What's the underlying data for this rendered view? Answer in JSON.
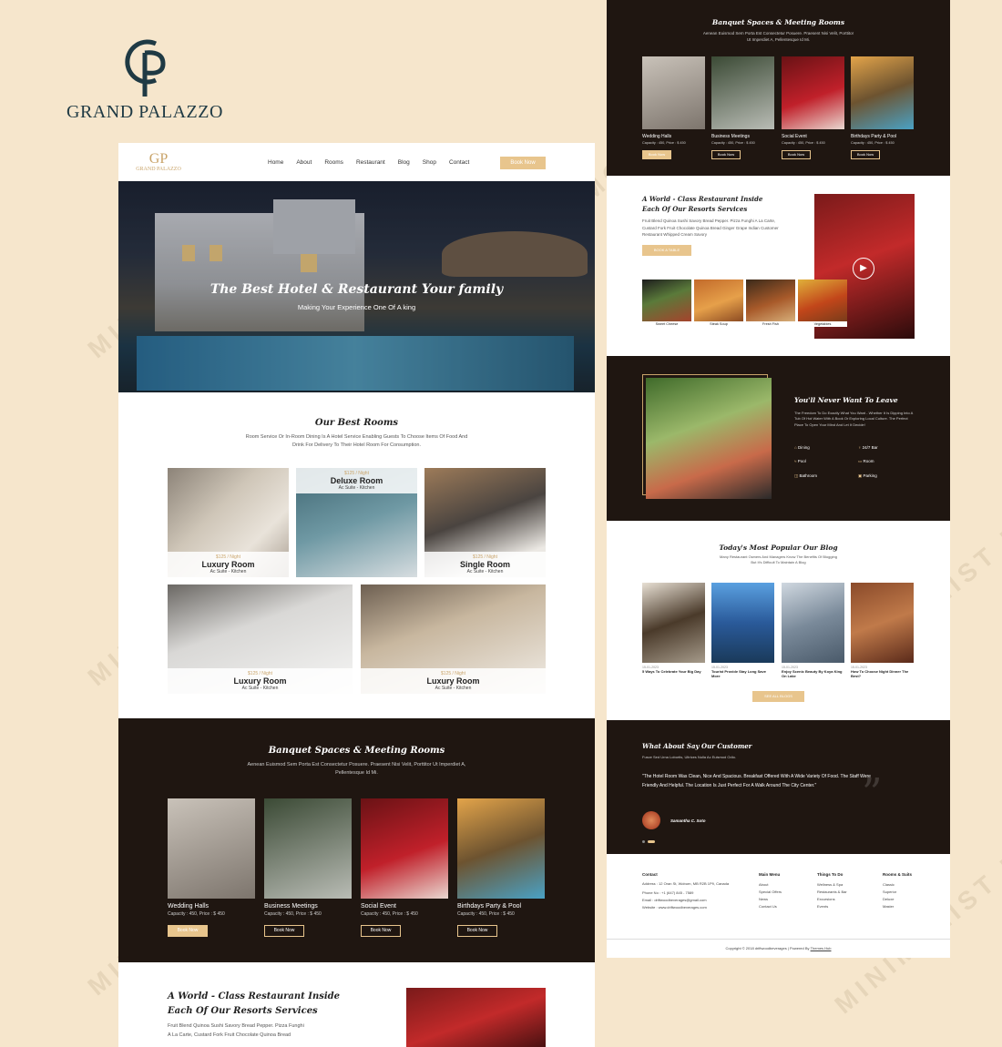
{
  "brand": {
    "monogram": "GP",
    "name": "GRAND PALAZZO"
  },
  "watermark": "MINIMALIST MOON",
  "left": {
    "logo": {
      "mark": "GP",
      "name": "GRAND PALAZZO"
    },
    "nav": [
      "Home",
      "About",
      "Rooms",
      "Restaurant",
      "Blog",
      "Shop",
      "Contact"
    ],
    "book_now": "Book Now",
    "hero": {
      "title": "The Best Hotel & Restaurant Your family",
      "subtitle": "Making Your Experience One Of A king"
    },
    "rooms": {
      "title": "Our Best Rooms",
      "subtitle": "Room Service Or In-Room Dining Is A Hotel Service Enabling Guests To Choose Items Of Food And Drink For Delivery To Their Hotel Room For Consumption.",
      "items": [
        {
          "price": "$125 / Night",
          "name": "Luxury Room",
          "amenities": "Ac Suite - Kitchen"
        },
        {
          "price": "$125 / Night",
          "name": "Deluxe Room",
          "amenities": "Ac Suite - Kitchen"
        },
        {
          "price": "$125 / Night",
          "name": "Single Room",
          "amenities": "Ac Suite - Kitchen"
        },
        {
          "price": "$125 / Night",
          "name": "Luxury Room",
          "amenities": "Ac Suite - Kitchen"
        },
        {
          "price": "$125 / Night",
          "name": "Luxury Room",
          "amenities": "Ac Suite - Kitchen"
        }
      ]
    },
    "banquet": {
      "title": "Banquet Spaces & Meeting Rooms",
      "subtitle": "Aenean Euismod Sem Porta Est Consectetur Posuere. Praesent Nisi Velit, Porttitor Ut Imperdiet A, Pellentesque Id Mi.",
      "items": [
        {
          "name": "Wedding Halls",
          "cap": "Capacity : 450, Price : $ 450",
          "btn": "Book Now"
        },
        {
          "name": "Business Meetings",
          "cap": "Capacity : 450, Price : $ 450",
          "btn": "Book Now"
        },
        {
          "name": "Social Event",
          "cap": "Capacity : 450, Price : $ 450",
          "btn": "Book Now"
        },
        {
          "name": "Birthdays Party & Pool",
          "cap": "Capacity : 450, Price : $ 450",
          "btn": "Book Now"
        }
      ]
    },
    "restaurant": {
      "title1": "A World - Class Restaurant Inside",
      "title2": "Each Of Our Resorts Services",
      "text1": "Fruit Blend Quinoa Sushi Savory Bread Pepper. Pizza Funghi",
      "text2": "A La Carte, Custard Fork Fruit Chocolate Quinoa Bread"
    }
  },
  "right": {
    "banquet": {
      "title": "Banquet Spaces & Meeting Rooms",
      "subtitle": "Aenean Euismod Sem Porta Est Consectetur Posuere. Praesent Nisi Velit, Porttitor Ut Imperdiet A, Pellentesque Id Mi.",
      "items": [
        {
          "name": "Wedding Halls",
          "cap": "Capacity : 450, Price : $ 450",
          "btn": "Book Now"
        },
        {
          "name": "Business Meetings",
          "cap": "Capacity : 450, Price : $ 450",
          "btn": "Book Now"
        },
        {
          "name": "Social Event",
          "cap": "Capacity : 450, Price : $ 450",
          "btn": "Book Now"
        },
        {
          "name": "Birthdays Party & Pool",
          "cap": "Capacity : 450, Price : $ 450",
          "btn": "Book Now"
        }
      ]
    },
    "restaurant": {
      "title1": "A World - Class Restaurant Inside",
      "title2": "Each Of Our Resorts Services",
      "text": "Fruit Blend Quinoa Sushi Savory Bread Pepper. Pizza Funghi A La Carte, Custard Fork Fruit Chocolate Quinoa Bread Ginger Grape Indian Customer Restaurant Whipped Cream Savory",
      "btn": "BOOK A TABLE",
      "foods": [
        "Sweet Cheese",
        "Steak Soup",
        "Fresh Fish",
        "Vegetables"
      ]
    },
    "features": {
      "title": "You'll Never Want To Leave",
      "text": "The Freedom To Do Exactly What You Want - Whether It Is Dipping Into A Tub Of Hot Water With A Book Or Exploring Local Culture. The Perfect Place To Open Your Mind And Let It Decide!",
      "items": [
        "Dining",
        "24/7 Bar",
        "Pool",
        "Room",
        "Bathroom",
        "Parking"
      ]
    },
    "blog": {
      "title": "Today's Most Popular Our Blog",
      "subtitle": "Many Restaurant Owners And Managers Know The Benefits Of Blogging But It's Difficult To Maintain A Blog",
      "posts": [
        {
          "date": "15-01-2023",
          "title": "5 Ways To Celebrate Your Big Day"
        },
        {
          "date": "15-01-2023",
          "title": "Tourist Provide Stay Long Save More"
        },
        {
          "date": "15-01-2023",
          "title": "Enjoy Scenic Beauty By Koya King On Lake"
        },
        {
          "date": "15-01-2023",
          "title": "How To Choose Night Dinner The Best?"
        }
      ],
      "btn": "SEE ALL BLOGS"
    },
    "testimonial": {
      "title": "What About Say Our Customer",
      "sub": "Fusce Sed Urna Lobortis, Ultrices Nulla Ac Euismod Odio.",
      "quote": "\"The Hotel Room Was Clean, Nice And Spacious. Breakfast Offered With A Wide Variety Of Food. The Staff Were Friendly And Helpful. The Location Is Just Perfect For A Walk Around The City Center.\"",
      "author": "Samantha C. Soto"
    },
    "footer": {
      "contact_h": "Contact",
      "address": "Address : 12 Oran St, Woburn, MB R2B 1P9, Canada",
      "phone": "Phone No : +1 (647) 845 - 7589",
      "email": "Email : driftwoodbeverages@gmail.com",
      "web": "Website : www.driftwoodbeverages.com",
      "cols": [
        {
          "h": "Main Menu",
          "items": [
            "About",
            "Special Offers",
            "News",
            "Contact Us"
          ]
        },
        {
          "h": "Things To Do",
          "items": [
            "Wellness & Spa",
            "Restaurants & Bar",
            "Excursions",
            "Events"
          ]
        },
        {
          "h": "Rooms & Suits",
          "items": [
            "Classic",
            "Superior",
            "Deluxe",
            "Master"
          ]
        }
      ],
      "copyright": "Copyright © 2018 driftwoodbeverages | Powered By",
      "powered": "Themes Hub"
    }
  }
}
